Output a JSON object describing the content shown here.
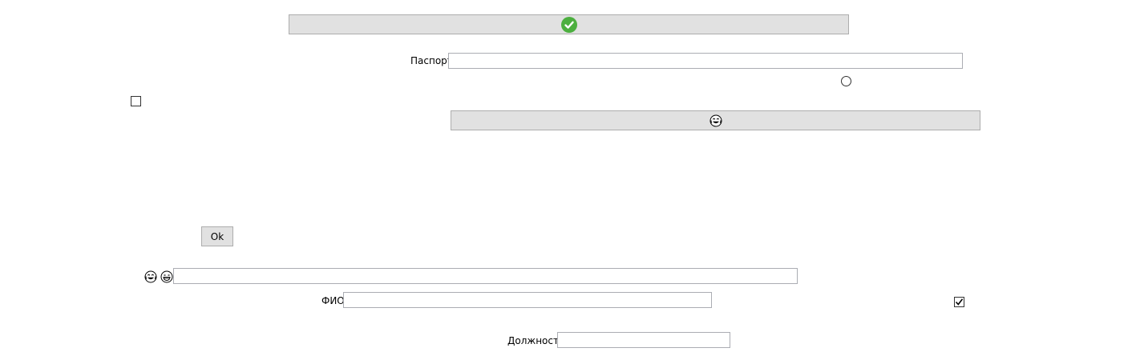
{
  "top_button": {
    "icon": "check-circle-icon",
    "icon_color": "#4caf3f"
  },
  "passport": {
    "label": "Паспорт",
    "value": ""
  },
  "radio_option": {
    "checked": false
  },
  "left_checkbox": {
    "checked": false
  },
  "emoji_button": {
    "icon": "laughing-tears-face-icon"
  },
  "ok_button": {
    "label": "Ok"
  },
  "emoji_input": {
    "icons": [
      "laughing-tears-face-icon",
      "grinning-face-icon"
    ],
    "value": ""
  },
  "fio": {
    "label": "ФИО",
    "value": ""
  },
  "right_checkbox": {
    "checked": true
  },
  "position": {
    "label": "Должность",
    "value": ""
  }
}
